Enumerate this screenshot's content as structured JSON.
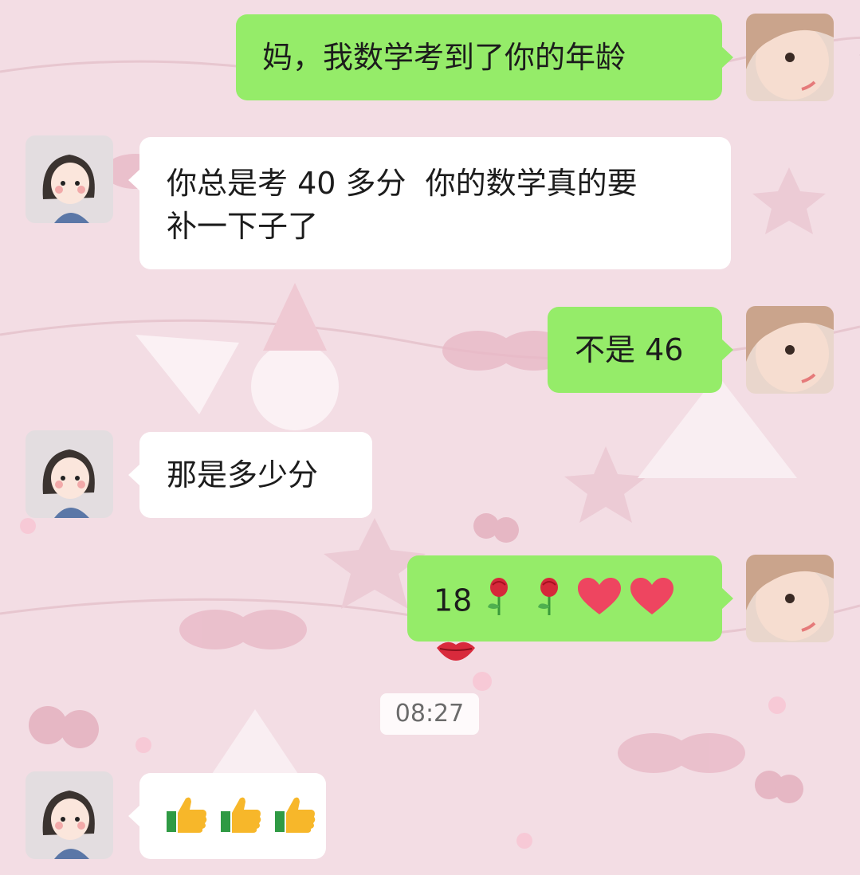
{
  "chat": {
    "messages": [
      {
        "side": "out",
        "text": "妈，我数学考到了你的年龄"
      },
      {
        "side": "in",
        "text": "你总是考 40 多分  你的数学真的要\n补一下子了"
      },
      {
        "side": "out",
        "text": "不是 46"
      },
      {
        "side": "in",
        "text": "那是多少分"
      },
      {
        "side": "out",
        "text": "18",
        "emoji": [
          "rose-icon",
          "rose-icon",
          "heart-icon",
          "heart-icon",
          "lips-icon"
        ]
      },
      {
        "side": "in",
        "emoji": [
          "thumbs-up-icon",
          "thumbs-up-icon",
          "thumbs-up-icon"
        ]
      }
    ],
    "timestamp": "08:27"
  },
  "colors": {
    "outgoing_bubble": "#95ec69",
    "incoming_bubble": "#ffffff",
    "background": "#f3dde4"
  }
}
